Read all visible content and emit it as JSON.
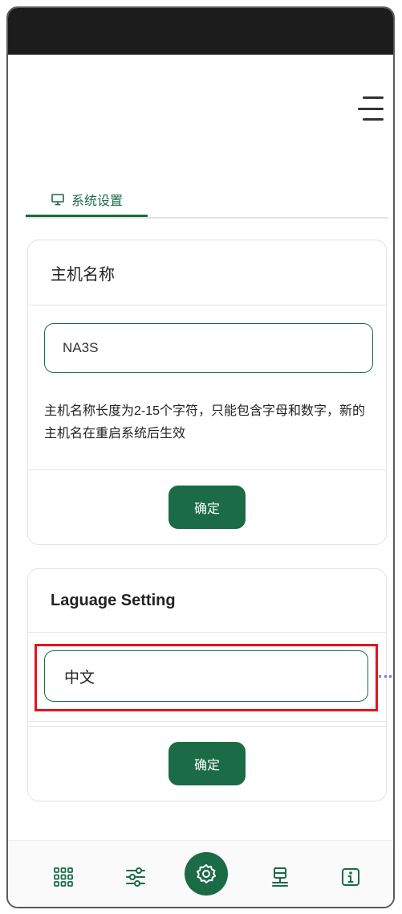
{
  "tab": {
    "label": "系统设置",
    "icon": "monitor-icon"
  },
  "hostname_card": {
    "title": "主机名称",
    "input_value": "NA3S",
    "hint": "主机名称长度为2-15个字符，只能包含字母和数字，新的主机名在重启系统后生效",
    "confirm_label": "确定"
  },
  "language_card": {
    "title": "Laguage Setting",
    "selected_value": "中文",
    "confirm_label": "确定"
  },
  "bottom_nav": {
    "items": [
      {
        "icon": "apps-grid-icon"
      },
      {
        "icon": "sliders-icon"
      },
      {
        "icon": "gear-icon",
        "active": true
      },
      {
        "icon": "network-icon"
      },
      {
        "icon": "info-icon"
      }
    ]
  },
  "colors": {
    "accent": "#1a6b46",
    "highlight": "#e0141e",
    "status_bar": "#1c1c1c"
  }
}
